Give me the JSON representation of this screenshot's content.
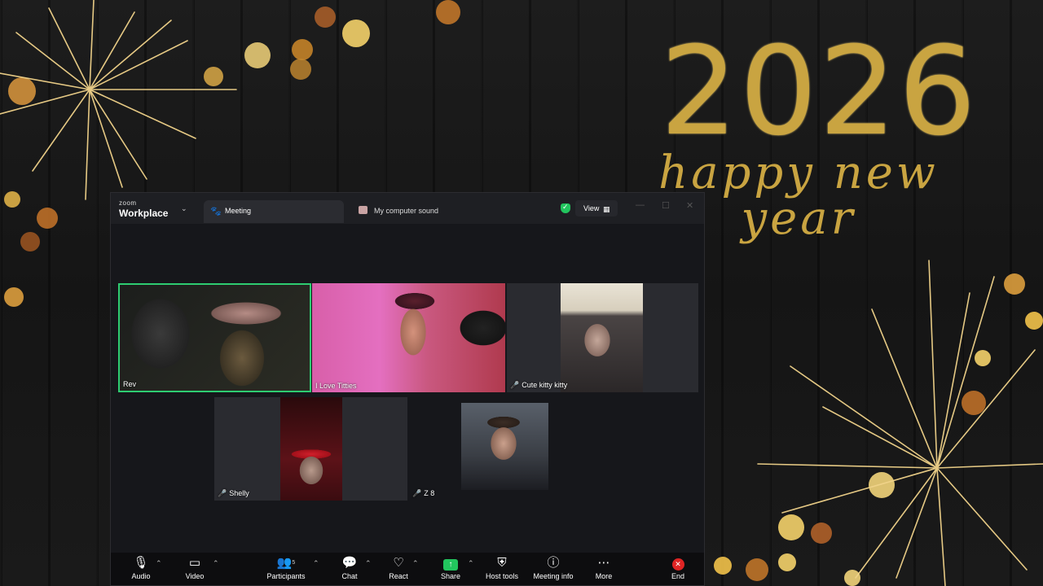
{
  "wallpaper": {
    "year": "2026",
    "greeting": "happy new year",
    "accent_color": "#c9a441"
  },
  "titlebar": {
    "brand_small": "zoom",
    "brand_large": "Workplace",
    "chevron_icon": "chevron-down-icon",
    "meeting_tab_label": "Meeting",
    "meeting_tab_icon": "paw-icon",
    "sound_tab_label": "My computer sound",
    "security_icon": "shield-check-icon",
    "view_label": "View",
    "view_icon": "grid-icon",
    "window_controls": [
      "—",
      "☐",
      "✕"
    ]
  },
  "participants": [
    {
      "name": "Rev",
      "muted": false,
      "active_speaker": true
    },
    {
      "name": "I Love Titties",
      "muted": false,
      "active_speaker": false
    },
    {
      "name": "Cute kitty kitty",
      "muted": true,
      "active_speaker": false
    },
    {
      "name": "Shelly",
      "muted": true,
      "active_speaker": false
    },
    {
      "name": "Z 8",
      "muted": true,
      "active_speaker": false
    }
  ],
  "toolbar": {
    "audio": "Audio",
    "video": "Video",
    "participants": "Participants",
    "participants_count": "5",
    "chat": "Chat",
    "react": "React",
    "share": "Share",
    "host_tools": "Host tools",
    "meeting_info": "Meeting info",
    "more": "More",
    "end": "End",
    "share_color": "#22c55e",
    "end_color": "#e02424"
  }
}
